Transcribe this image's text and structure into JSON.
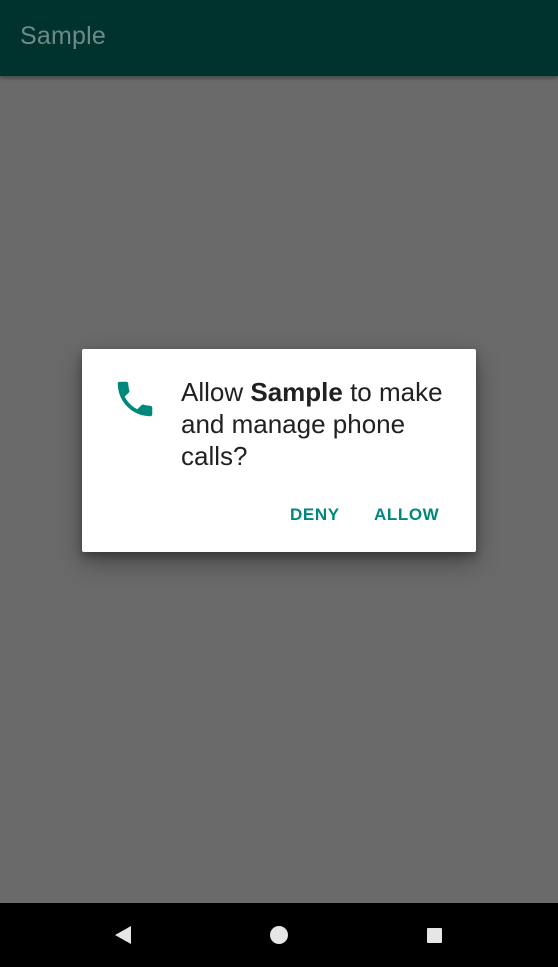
{
  "app_bar": {
    "title": "Sample"
  },
  "dialog": {
    "icon": "phone-icon",
    "message_prefix": "Allow ",
    "app_name": "Sample",
    "message_suffix": " to make and manage phone calls?",
    "deny_label": "DENY",
    "allow_label": "ALLOW"
  },
  "nav_bar": {
    "back": "back-icon",
    "home": "home-icon",
    "recents": "recents-icon"
  },
  "colors": {
    "app_bar_bg": "#00332e",
    "scrim": "#6a6a6a",
    "accent": "#00897b",
    "text_primary": "#212121"
  }
}
